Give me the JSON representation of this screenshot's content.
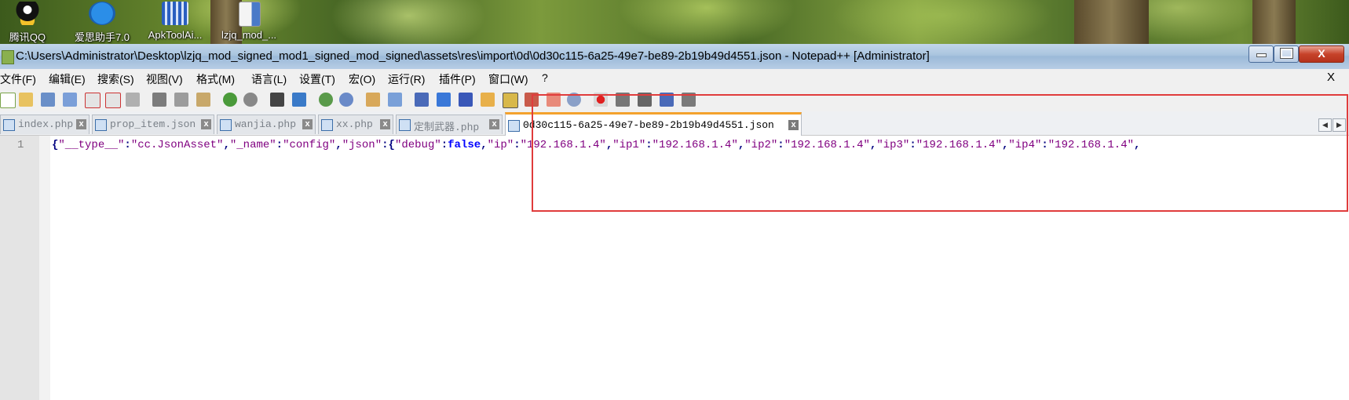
{
  "desktop": {
    "icons": [
      {
        "label": "腾讯QQ",
        "icon": "qq-penguin-icon"
      },
      {
        "label": "爱思助手7.0",
        "icon": "i4-assistant-icon"
      },
      {
        "label": "ApkToolAi...",
        "icon": "apktool-icon"
      },
      {
        "label": "lzjq_mod_...",
        "icon": "file-icon"
      }
    ]
  },
  "window": {
    "title": "C:\\Users\\Administrator\\Desktop\\lzjq_mod_signed_mod1_signed_mod_signed\\assets\\res\\import\\0d\\0d30c115-6a25-49e7-be89-2b19b49d4551.json - Notepad++ [Administrator]",
    "close_glyph": "X"
  },
  "menu": {
    "items": [
      "文件(F)",
      "编辑(E)",
      "搜索(S)",
      "视图(V)",
      "格式(M)",
      "语言(L)",
      "设置(T)",
      "宏(O)",
      "运行(R)",
      "插件(P)",
      "窗口(W)",
      "?"
    ],
    "close_label": "X"
  },
  "tabs": [
    {
      "label": "index.php",
      "active": false
    },
    {
      "label": "prop_item.json",
      "active": false
    },
    {
      "label": "wanjia.php",
      "active": false
    },
    {
      "label": "xx.php",
      "active": false
    },
    {
      "label": "定制武器.php",
      "active": false
    },
    {
      "label": "0d30c115-6a25-49e7-be89-2b19b49d4551.json",
      "active": true
    }
  ],
  "tab_close_glyph": "x",
  "editor": {
    "line_number": "1",
    "tokens": [
      {
        "t": "{",
        "c": "op"
      },
      {
        "t": "\"__type__\"",
        "c": "str"
      },
      {
        "t": ":",
        "c": "op"
      },
      {
        "t": "\"cc.JsonAsset\"",
        "c": "str"
      },
      {
        "t": ",",
        "c": "op"
      },
      {
        "t": "\"_name\"",
        "c": "str"
      },
      {
        "t": ":",
        "c": "op"
      },
      {
        "t": "\"config\"",
        "c": "str"
      },
      {
        "t": ",",
        "c": "op"
      },
      {
        "t": "\"json\"",
        "c": "str"
      },
      {
        "t": ":",
        "c": "op"
      },
      {
        "t": "{",
        "c": "op"
      },
      {
        "t": "\"debug\"",
        "c": "str"
      },
      {
        "t": ":",
        "c": "op"
      },
      {
        "t": "false",
        "c": "kw"
      },
      {
        "t": ",",
        "c": "op"
      },
      {
        "t": "\"ip\"",
        "c": "str"
      },
      {
        "t": ":",
        "c": "op"
      },
      {
        "t": "\"192.168.1.4\"",
        "c": "str"
      },
      {
        "t": ",",
        "c": "op"
      },
      {
        "t": "\"ip1\"",
        "c": "str"
      },
      {
        "t": ":",
        "c": "op"
      },
      {
        "t": "\"192.168.1.4\"",
        "c": "str"
      },
      {
        "t": ",",
        "c": "op"
      },
      {
        "t": "\"ip2\"",
        "c": "str"
      },
      {
        "t": ":",
        "c": "op"
      },
      {
        "t": "\"192.168.1.4\"",
        "c": "str"
      },
      {
        "t": ",",
        "c": "op"
      },
      {
        "t": "\"ip3\"",
        "c": "str"
      },
      {
        "t": ":",
        "c": "op"
      },
      {
        "t": "\"192.168.1.4\"",
        "c": "str"
      },
      {
        "t": ",",
        "c": "op"
      },
      {
        "t": "\"ip4\"",
        "c": "str"
      },
      {
        "t": ":",
        "c": "op"
      },
      {
        "t": "\"192.168.1.4\"",
        "c": "str"
      },
      {
        "t": ",",
        "c": "op"
      }
    ]
  },
  "colors": {
    "highlight_box": "#e03c3c",
    "active_tab_accent": "#f4a22d",
    "string": "#800080",
    "operator": "#000080",
    "keyword": "#0000ff"
  }
}
